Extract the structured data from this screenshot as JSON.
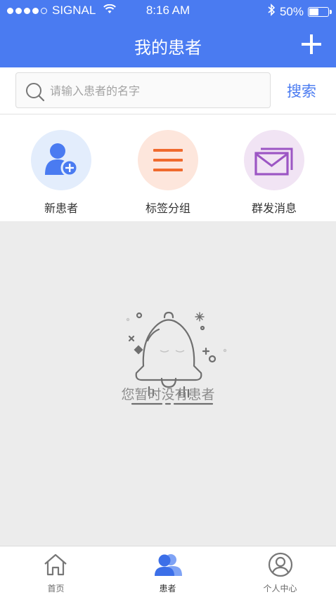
{
  "status_bar": {
    "carrier": "SIGNAL",
    "time": "8:16 AM",
    "battery_percent": "50%",
    "battery_level": 0.5,
    "icons": [
      "signal-dots-icon",
      "wifi-icon",
      "bluetooth-icon",
      "battery-icon"
    ]
  },
  "nav": {
    "title": "我的患者",
    "add_icon": "plus-icon"
  },
  "search": {
    "placeholder": "请输入患者的名字",
    "value": "",
    "button_label": "搜索",
    "icon": "search-icon"
  },
  "actions": [
    {
      "label": "新患者",
      "icon": "add-patient-icon",
      "color": "#4a7bf1",
      "bg": "#e3edfc"
    },
    {
      "label": "标签分组",
      "icon": "list-icon",
      "color": "#f06a2e",
      "bg": "#fde6dc"
    },
    {
      "label": "群发消息",
      "icon": "mail-icon",
      "color": "#9c56c4",
      "bg": "#f1e4f4"
    }
  ],
  "empty_state": {
    "message": "您暂时没有患者",
    "icon": "bell-illustration-icon"
  },
  "tabs": [
    {
      "label": "首页",
      "icon": "home-icon",
      "active": false
    },
    {
      "label": "患者",
      "icon": "patients-icon",
      "active": true
    },
    {
      "label": "个人中心",
      "icon": "profile-icon",
      "active": false
    }
  ],
  "colors": {
    "primary": "#4a7bf1",
    "background": "#ececec"
  }
}
